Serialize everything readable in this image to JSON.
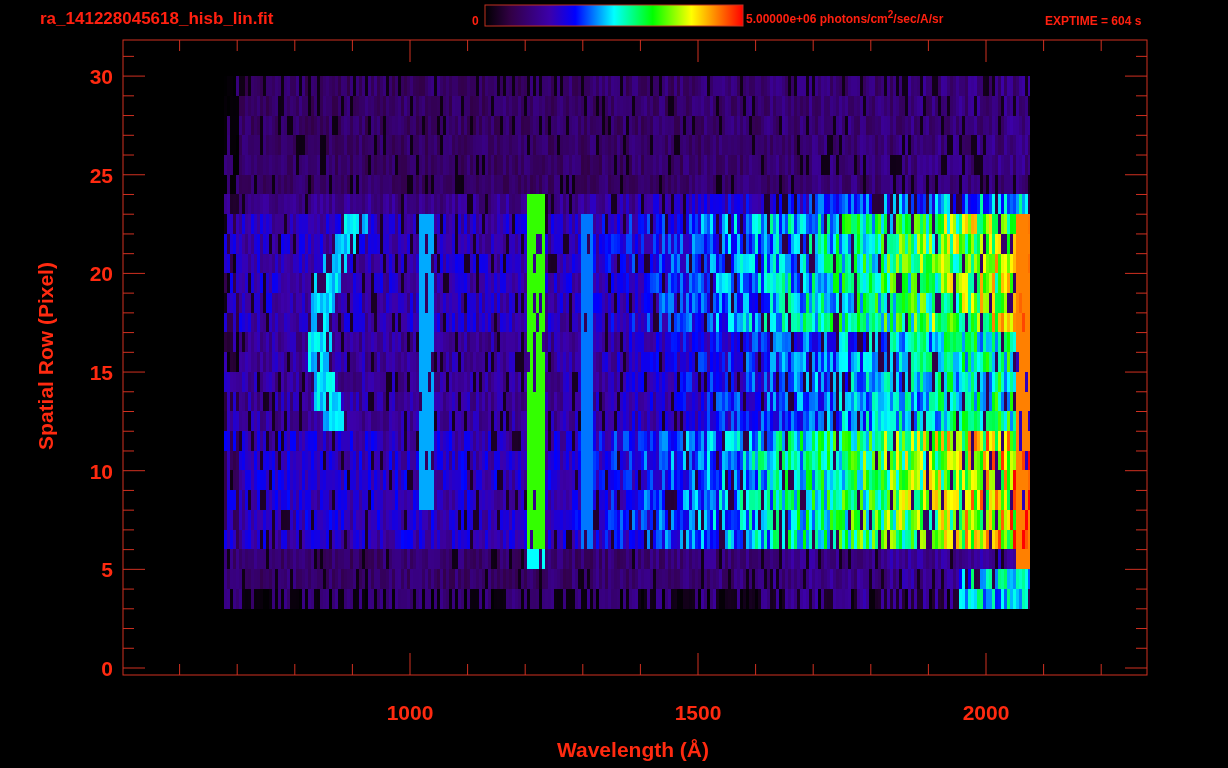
{
  "title": "ra_141228045618_hisb_lin.fit",
  "colorbar": {
    "min_label": "0",
    "max_label": "5.00000e+06 photons/cm$^{2}$/sec/A/sr"
  },
  "exptime": "EXPTIME = 604 s",
  "plot": {
    "y_axis": {
      "label": "Spatial Row (Pixel)",
      "ticks": [
        "30",
        "25",
        "20",
        "15",
        "10",
        "5",
        "0"
      ]
    },
    "x_axis": {
      "label": "Wavelength (Å)",
      "ticks": [
        "1000",
        "1500",
        "2000"
      ]
    }
  }
}
